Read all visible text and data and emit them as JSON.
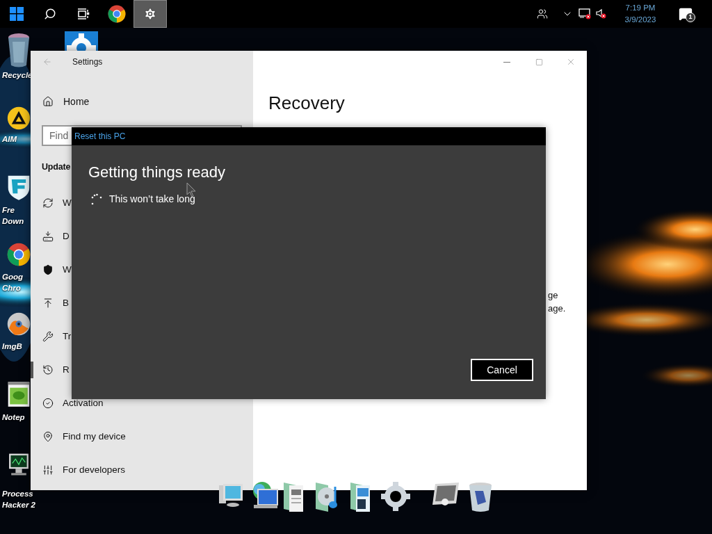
{
  "taskbar": {
    "buttons": [
      {
        "kind": "start",
        "selected": false
      },
      {
        "kind": "search",
        "selected": false
      },
      {
        "kind": "task_view",
        "selected": false
      },
      {
        "kind": "chrome",
        "selected": false
      },
      {
        "kind": "settings",
        "selected": true
      }
    ],
    "tray": {
      "time": "7:19 PM",
      "date": "3/9/2023",
      "notification_count": "1"
    }
  },
  "desktop_icons": [
    {
      "kind": "recycle",
      "label": [
        "Recycle"
      ]
    },
    {
      "kind": "aim",
      "label": [
        "AIM"
      ]
    },
    {
      "kind": "shield_app",
      "label": [
        "Fre",
        "Down"
      ]
    },
    {
      "kind": "chrome",
      "label": [
        "Goog",
        "Chro"
      ]
    },
    {
      "kind": "disc",
      "label": [
        "ImgB"
      ]
    },
    {
      "kind": "notepad",
      "label": [
        "Notep"
      ]
    },
    {
      "kind": "monitor",
      "label": [
        "Process",
        "Hacker 2"
      ]
    },
    {
      "kind": "gear"
    }
  ],
  "settings_window": {
    "title": "Settings",
    "sidebar": {
      "home": "Home",
      "search": {
        "placeholder": "Find"
      },
      "section_heading": "Update",
      "items": [
        {
          "kind": "sync",
          "label": "W",
          "selected": false
        },
        {
          "kind": "delivery",
          "label": "D",
          "selected": false
        },
        {
          "kind": "shield",
          "label": "W",
          "selected": false
        },
        {
          "kind": "backup",
          "label": "B",
          "selected": false
        },
        {
          "kind": "troubleshoot",
          "label": "Tr",
          "selected": false
        },
        {
          "kind": "recovery",
          "label": "R",
          "selected": true
        },
        {
          "kind": "activation",
          "label": "Activation",
          "selected": false
        },
        {
          "kind": "find_device",
          "label": "Find my device",
          "selected": false
        },
        {
          "kind": "developers",
          "label": "For developers",
          "selected": false
        }
      ]
    },
    "page_title": "Recovery",
    "partial_lines": [
      "ge",
      "age."
    ]
  },
  "dialog": {
    "title": "Reset this PC",
    "heading": "Getting things ready",
    "status": "This won’t take long",
    "buttons": [
      "Cancel"
    ]
  },
  "dock": [
    {
      "kind": "computer"
    },
    {
      "kind": "network"
    },
    {
      "kind": "documents"
    },
    {
      "kind": "music"
    },
    {
      "kind": "pictures"
    },
    {
      "kind": "gear"
    },
    {
      "kind": "frame"
    },
    {
      "kind": "bin"
    }
  ]
}
